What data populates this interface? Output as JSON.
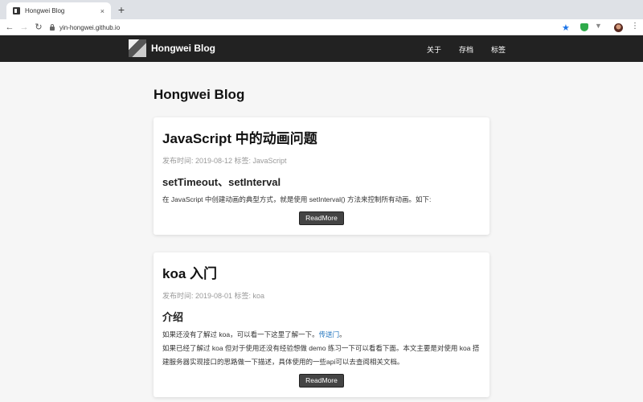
{
  "browser": {
    "tab_title": "Hongwei Blog",
    "close_glyph": "×",
    "new_tab_glyph": "+",
    "url": "yin-hongwei.github.io"
  },
  "site": {
    "brand": "Hongwei Blog",
    "nav": [
      "关于",
      "存档",
      "标签"
    ],
    "page_title": "Hongwei Blog"
  },
  "posts": [
    {
      "title": "JavaScript 中的动画问题",
      "meta": "发布时间: 2019-08-12   标签: JavaScript",
      "heading": "setTimeout、setInterval",
      "paragraphs": [
        "在 JavaScript 中创建动画的典型方式，就是使用 setInterval() 方法来控制所有动画。如下:"
      ],
      "button": "ReadMore"
    },
    {
      "title": "koa 入门",
      "meta": "发布时间: 2019-08-01   标签: koa",
      "heading": "介绍",
      "p1_before": "如果还没有了解过 koa，可以看一下这里了解一下。",
      "p1_link": "传送门",
      "p1_after": "。",
      "p2": "如果已经了解过 koa 但对于使用还没有经验想做 demo 练习一下可以看看下面。本文主要是对使用 koa 搭建服务器实现接口的思路做一下描述，具体使用的一些api可以去查阅相关文档。",
      "button": "ReadMore"
    }
  ]
}
